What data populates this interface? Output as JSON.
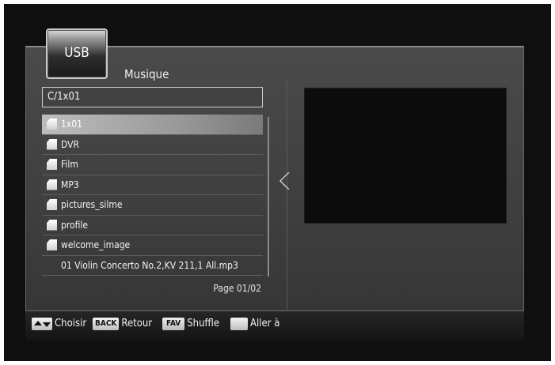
{
  "header": {
    "source_tab": "USB",
    "folder_title": "Musique",
    "path": "C/1x01"
  },
  "list": {
    "items": [
      {
        "label": "1x01",
        "type": "folder",
        "selected": true
      },
      {
        "label": "DVR",
        "type": "folder"
      },
      {
        "label": "Film",
        "type": "folder"
      },
      {
        "label": "MP3",
        "type": "folder"
      },
      {
        "label": "pictures_silme",
        "type": "folder"
      },
      {
        "label": "profile",
        "type": "folder"
      },
      {
        "label": "welcome_image",
        "type": "folder"
      },
      {
        "label": "01 Violin Concerto No.2,KV 211,1 All.mp3",
        "type": "file"
      }
    ],
    "page": "Page  01/02"
  },
  "footer": {
    "updown_label": "Choisir",
    "back_key": "BACK",
    "back_label": "Retour",
    "fav_key": "FAV",
    "fav_label": "Shuffle",
    "goto_label": "Aller à"
  },
  "icons": {
    "folder": "folder-icon",
    "updown": "up-down-arrows-icon"
  }
}
